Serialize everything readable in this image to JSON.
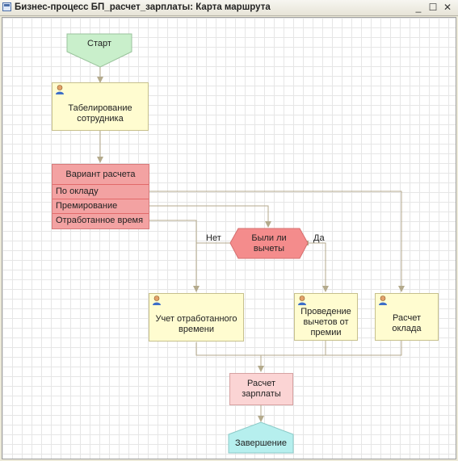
{
  "window": {
    "title": "Бизнес-процесс БП_расчет_зарплаты: Карта маршрута",
    "minimize_glyph": "_",
    "maximize_glyph": "☐",
    "close_glyph": "✕"
  },
  "map": {
    "start": "Старт",
    "task_tabel": "Табелирование сотрудника",
    "choice": {
      "header": "Вариант расчета",
      "options": [
        "По окладу",
        "Премирование",
        "Отработанное время"
      ]
    },
    "condition": "Были ли вычеты",
    "edge_no": "Нет",
    "edge_yes": "Да",
    "task_worked": "Учет отработанного времени",
    "task_deductions": "Проведение вычетов от премии",
    "task_salary": "Расчет оклада",
    "calc_pay": "Расчет зарплаты",
    "end": "Завершение"
  },
  "colors": {
    "start": "#c9efcb",
    "task": "#fffcd0",
    "choice": "#f3a2a2",
    "condition": "#f48c8c",
    "calc": "#fbd4d4",
    "end": "#b6efee",
    "connector": "#b4aa8c"
  },
  "icons": {
    "task": "user-icon",
    "window": "process-map-icon"
  }
}
